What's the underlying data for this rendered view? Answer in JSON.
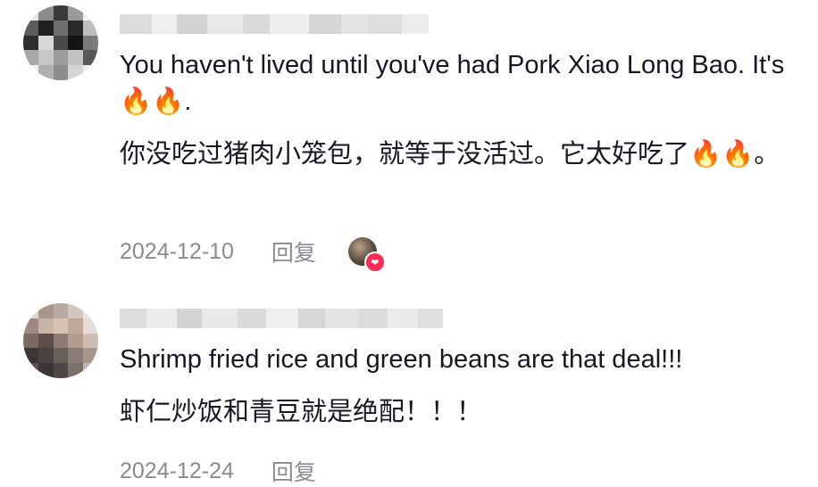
{
  "comments": [
    {
      "text_en": "You haven't lived until you've had Pork Xiao Long Bao. It's 🔥🔥.",
      "text_zh": "你没吃过猪肉小笼包，就等于没活过。它太好吃了🔥🔥。",
      "date": "2024-12-10",
      "reply_label": "回复",
      "liked_by_author": true
    },
    {
      "text_en": "Shrimp fried rice and green beans are that deal!!!",
      "text_zh": "虾仁炒饭和青豆就是绝配！！！",
      "date": "2024-12-24",
      "reply_label": "回复",
      "liked_by_author": false
    }
  ],
  "colors": {
    "text": "#161823",
    "meta": "#8a8b91",
    "like_badge": "#fe2c55"
  },
  "icons": {
    "like_badge": "heart-icon"
  }
}
